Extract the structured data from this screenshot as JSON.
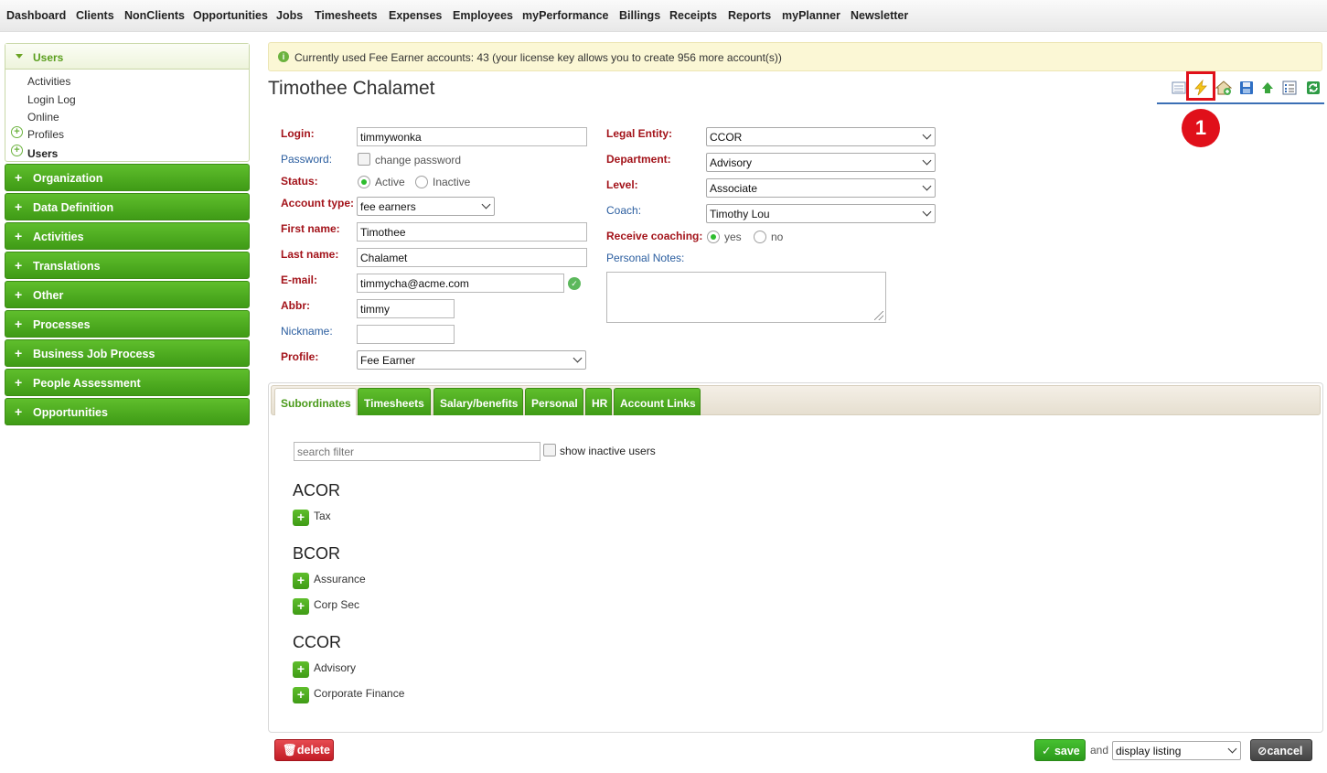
{
  "nav": [
    "Dashboard",
    "Clients",
    "NonClients",
    "Opportunities",
    "Jobs",
    "Timesheets",
    "Expenses",
    "Employees",
    "myPerformance",
    "Billings",
    "Receipts",
    "Reports",
    "myPlanner",
    "Newsletter"
  ],
  "sidebar": {
    "users_section": {
      "title": "Users",
      "items": [
        "Activities",
        "Login Log",
        "Online",
        "Profiles",
        "Users"
      ]
    },
    "sections": [
      "Organization",
      "Data Definition",
      "Activities",
      "Translations",
      "Other",
      "Processes",
      "Business Job Process",
      "People Assessment",
      "Opportunities"
    ]
  },
  "notice": "Currently used Fee Earner accounts: 43 (your license key allows you to create 956 more account(s))",
  "page_title": "Timothee Chalamet",
  "highlight_badge": "1",
  "toolbar_icons": [
    "report-icon",
    "lightning-icon",
    "home-icon",
    "save-disk-icon",
    "arrow-up-icon",
    "list-icon",
    "refresh-icon"
  ],
  "form": {
    "login": {
      "label": "Login:",
      "value": "timmywonka"
    },
    "password": {
      "label": "Password:",
      "checkbox_label": "change password"
    },
    "status": {
      "label": "Status:",
      "options": [
        "Active",
        "Inactive"
      ],
      "selected": "Active"
    },
    "account_type": {
      "label": "Account type:",
      "value": "fee earners"
    },
    "first_name": {
      "label": "First name:",
      "value": "Timothee"
    },
    "last_name": {
      "label": "Last name:",
      "value": "Chalamet"
    },
    "email": {
      "label": "E-mail:",
      "value": "timmycha@acme.com"
    },
    "abbr": {
      "label": "Abbr:",
      "value": "timmy"
    },
    "nickname": {
      "label": "Nickname:",
      "value": ""
    },
    "profile": {
      "label": "Profile:",
      "value": "Fee Earner"
    },
    "legal_entity": {
      "label": "Legal Entity:",
      "value": "CCOR"
    },
    "department": {
      "label": "Department:",
      "value": "Advisory"
    },
    "level": {
      "label": "Level:",
      "value": "Associate"
    },
    "coach": {
      "label": "Coach:",
      "value": "Timothy Lou"
    },
    "receive_coaching": {
      "label": "Receive coaching:",
      "options": [
        "yes",
        "no"
      ],
      "selected": "yes"
    },
    "personal_notes": {
      "label": "Personal Notes:",
      "value": ""
    }
  },
  "tabs": [
    "Subordinates",
    "Timesheets",
    "Salary/benefits",
    "Personal",
    "HR",
    "Account Links"
  ],
  "active_tab": "Subordinates",
  "subordinates": {
    "search_placeholder": "search filter",
    "show_inactive_label": "show inactive users",
    "groups": [
      {
        "name": "ACOR",
        "items": [
          "Tax"
        ]
      },
      {
        "name": "BCOR",
        "items": [
          "Assurance",
          "Corp Sec"
        ]
      },
      {
        "name": "CCOR",
        "items": [
          "Advisory",
          "Corporate Finance"
        ]
      }
    ]
  },
  "footer": {
    "delete_label": "delete",
    "save_label": "save",
    "and_text": "and",
    "after_save_option": "display listing",
    "cancel_label": "cancel"
  },
  "colors": {
    "accent_green": "#4caf1f",
    "required_label": "#a3131a",
    "optional_label": "#2a5d9f",
    "highlight_red": "#e0101a"
  }
}
